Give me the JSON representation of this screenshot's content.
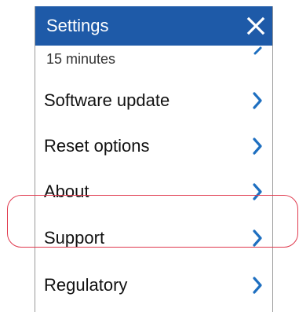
{
  "header": {
    "title": "Settings",
    "close_icon": "close-icon"
  },
  "partial_item": {
    "value": "15 minutes",
    "icon": "chevron-right-icon"
  },
  "items": [
    {
      "label": "Software update",
      "icon": "chevron-right-icon"
    },
    {
      "label": "Reset options",
      "icon": "chevron-right-icon"
    },
    {
      "label": "About",
      "icon": "chevron-right-icon"
    },
    {
      "label": "Support",
      "icon": "chevron-right-icon",
      "highlighted": true
    },
    {
      "label": "Regulatory",
      "icon": "chevron-right-icon"
    }
  ],
  "colors": {
    "header_bg": "#1e5aa8",
    "chevron": "#1e6fc0",
    "highlight": "#e03a4e"
  }
}
